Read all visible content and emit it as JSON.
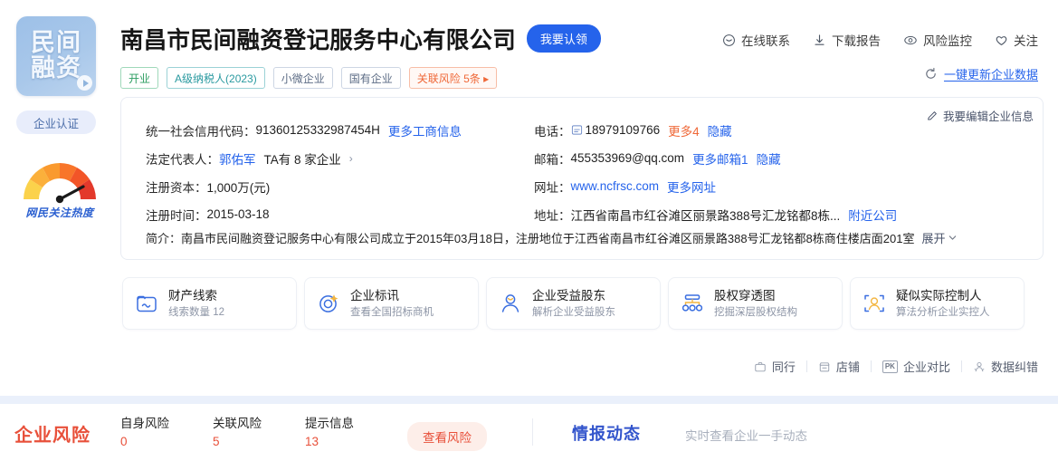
{
  "sidebar": {
    "logo_line1": "民间",
    "logo_line2": "融资",
    "cert_label": "企业认证",
    "gauge_label": "网民关注热度"
  },
  "header": {
    "company_name": "南昌市民间融资登记服务中心有限公司",
    "claim_button": "我要认领",
    "tags": [
      {
        "label": "开业",
        "style": "green"
      },
      {
        "label": "A级纳税人(2023)",
        "style": "teal"
      },
      {
        "label": "小微企业",
        "style": "gray"
      },
      {
        "label": "国有企业",
        "style": "gray"
      },
      {
        "label": "关联风险 5条 ▸",
        "style": "risk"
      }
    ]
  },
  "top_actions": [
    {
      "label": "在线联系",
      "icon": "chat-icon"
    },
    {
      "label": "下载报告",
      "icon": "download-icon"
    },
    {
      "label": "风险监控",
      "icon": "eye-icon"
    },
    {
      "label": "关注",
      "icon": "heart-icon"
    }
  ],
  "refresh": {
    "icon": "refresh-icon",
    "label": "一键更新企业数据"
  },
  "info_card": {
    "edit_label": "我要编辑企业信息",
    "edit_icon": "pencil-icon",
    "left_rows": [
      {
        "label": "统一社会信用代码：",
        "value": "91360125332987454H",
        "link": "更多工商信息"
      },
      {
        "label": "法定代表人：",
        "value": "郭佑军",
        "extra": "TA有 8 家企业",
        "chevron": "›"
      },
      {
        "label": "注册资本：",
        "value": "1,000万(元)"
      },
      {
        "label": "注册时间：",
        "value": "2015-03-18"
      }
    ],
    "right_rows": [
      {
        "label": "电话：",
        "value": "18979109766",
        "icon": "phone-card-icon",
        "more": "更多4",
        "hide": "隐藏"
      },
      {
        "label": "邮箱：",
        "value": "455353969@qq.com",
        "more": "更多邮箱1",
        "hide": "隐藏"
      },
      {
        "label": "网址：",
        "value": "www.ncfrsc.com",
        "more": "更多网址"
      },
      {
        "label": "地址：",
        "value": "江西省南昌市红谷滩区丽景路388号汇龙铭都8栋...",
        "more": "附近公司"
      }
    ],
    "description_label": "简介：",
    "description": "南昌市民间融资登记服务中心有限公司成立于2015年03月18日，注册地位于江西省南昌市红谷滩区丽景路388号汇龙铭都8栋商住楼店面201室",
    "expand_label": "展开",
    "expand_icon": "chevron-down-icon"
  },
  "feature_cards": [
    {
      "title": "财产线索",
      "subtitle": "线索数量 12",
      "icon": "property-clue-icon"
    },
    {
      "title": "企业标讯",
      "subtitle": "查看全国招标商机",
      "icon": "bid-target-icon"
    },
    {
      "title": "企业受益股东",
      "subtitle": "解析企业受益股东",
      "icon": "beneficiary-icon"
    },
    {
      "title": "股权穿透图",
      "subtitle": "挖掘深层股权结构",
      "icon": "equity-chart-icon"
    },
    {
      "title": "疑似实际控制人",
      "subtitle": "算法分析企业实控人",
      "icon": "actual-controller-icon"
    }
  ],
  "tools": [
    {
      "label": "同行",
      "icon": "briefcase-icon"
    },
    {
      "label": "店铺",
      "icon": "shop-icon"
    },
    {
      "label": "企业对比",
      "icon": "pk-icon"
    },
    {
      "label": "数据纠错",
      "icon": "correction-icon"
    }
  ],
  "risk_bar": {
    "title": "企业风险",
    "items": [
      {
        "label": "自身风险",
        "count": "0"
      },
      {
        "label": "关联风险",
        "count": "5"
      },
      {
        "label": "提示信息",
        "count": "13"
      }
    ],
    "view_button": "查看风险",
    "intel_title": "情报动态",
    "intel_subtitle": "实时查看企业一手动态"
  },
  "colors": {
    "brand_blue": "#2563eb",
    "risk_red": "#e8503a",
    "orange": "#ef6838",
    "green": "#2e9e62",
    "teal": "#2a9aa0",
    "intel_blue": "#3355cc"
  }
}
